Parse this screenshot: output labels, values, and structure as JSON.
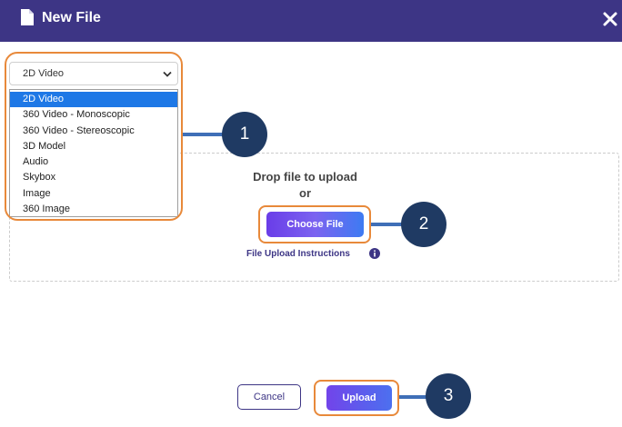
{
  "dialog": {
    "title": "New File",
    "doc_icon": "document-icon",
    "close_icon": "close-icon"
  },
  "file_type": {
    "selected": "2D Video",
    "options": [
      "2D Video",
      "360 Video - Monoscopic",
      "360 Video - Stereoscopic",
      "3D Model",
      "Audio",
      "Skybox",
      "Image",
      "360 Image"
    ]
  },
  "upload_area": {
    "drop_text": "Drop file to upload",
    "or_text": "or",
    "choose_file_label": "Choose File",
    "instructions_label": "File Upload Instructions",
    "info_icon": "info-icon"
  },
  "footer": {
    "cancel_label": "Cancel",
    "upload_label": "Upload"
  },
  "annotations": {
    "badges": [
      "1",
      "2",
      "3"
    ]
  },
  "colors": {
    "header": "#3d3585",
    "selected_option": "#1e78e6",
    "highlight": "#e8893a",
    "badge": "#1f3a63",
    "connector": "#3f6fb7"
  }
}
